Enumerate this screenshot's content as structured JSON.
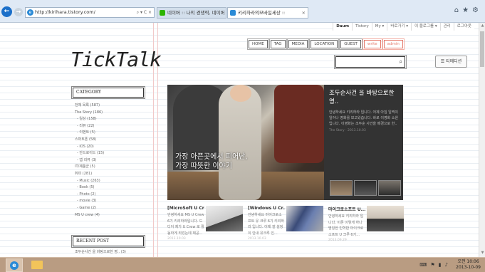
{
  "browser": {
    "url": "http://kirihara.tistory.com/",
    "tabs": [
      {
        "label": "네이버 :: 나의 경쟁력, 네이버"
      },
      {
        "label": "키리하라의모바일세상 ::"
      }
    ]
  },
  "top_links": [
    "Daum",
    "Tistory",
    "My ▾",
    "바로가기 ▾",
    "이 블로그를 ▾",
    "관리",
    "로그아웃"
  ],
  "site": {
    "logo": "TickTalk",
    "menu": [
      "HOME",
      "TAG",
      "MEDIA",
      "LOCATION",
      "GUEST",
      "write",
      "admin"
    ],
    "search_placeholder": "",
    "theme_button": "티에디션"
  },
  "sidebar": {
    "category_title": "CATEGORY",
    "categories": [
      {
        "label": "전체 목록 (587)",
        "sub": false
      },
      {
        "label": "The Story (186)",
        "sub": false
      },
      {
        "label": "- 일상 (158)",
        "sub": true
      },
      {
        "label": "- 리뷰 (22)",
        "sub": true
      },
      {
        "label": "- 이벤트 (5)",
        "sub": true
      },
      {
        "label": "스마트폰 (58)",
        "sub": false
      },
      {
        "label": "- iOS (20)",
        "sub": true
      },
      {
        "label": "- 안드로이드 (15)",
        "sub": true
      },
      {
        "label": "- 앱 리뷰 (3)",
        "sub": true
      },
      {
        "label": "IT/제품군 (5)",
        "sub": false
      },
      {
        "label": "취미 (281)",
        "sub": false
      },
      {
        "label": "- Music (263)",
        "sub": true
      },
      {
        "label": "- Book (5)",
        "sub": true
      },
      {
        "label": "- Photo (2)",
        "sub": true
      },
      {
        "label": "- movie (3)",
        "sub": true
      },
      {
        "label": "- Game (2)",
        "sub": true
      },
      {
        "label": "MS U crew (4)",
        "sub": false
      }
    ],
    "recent_title": "RECENT POST",
    "recent_first": "조두순사건 을 바탕으로한 영.. (3)"
  },
  "feature": {
    "caption_line1": "가장 아픈곳에서 피어난,",
    "caption_line2": "가장 따뜻한 이야기",
    "panel_title": "조두순사건 을 바탕으로한 영..",
    "panel_text": "안녕하세요 키리하라 입니다. 어제 아침 일찍이 일어나 영화를 보고왔습니다. 바로 이영화 소원 입니다. 이영화는 조두순 사건을 배경으로 한..",
    "panel_meta": "The Story · 2013.10.03"
  },
  "cards": [
    {
      "title": "[MicroSoft U Cre...",
      "body": "안녕하세요 MS U Crew 6기 키리하라입니다. 드디어 제가 U Crew 로 활동하게 되었는데 제공...",
      "date": "2013.10.03",
      "img_color": "#c9c9c9"
    },
    {
      "title": "[Windows U Cr...",
      "body": "안녕하세요 마이크로소프트 유 크루 6기 키리하라 입니다. 어제 잘 설정이 안내 유크루 인...",
      "date": "2013.10.03",
      "img_color": "#3a4b78"
    },
    {
      "title": "마이크로소프트 U...",
      "body": "안녕하세요 키리하라 입니다. 이론 이렇게 하나 명칭한 민혁판 마이크로소프트 U 크루 6기...",
      "date": "2013.09.29",
      "img_color": "#c8bfb3"
    }
  ],
  "clock": {
    "time": "오전 10:06",
    "date": "2013-10-09"
  },
  "colors": {
    "accent_red": "#e57a6c",
    "panel_dark": "#333333",
    "taskbar": "#b99c82"
  }
}
